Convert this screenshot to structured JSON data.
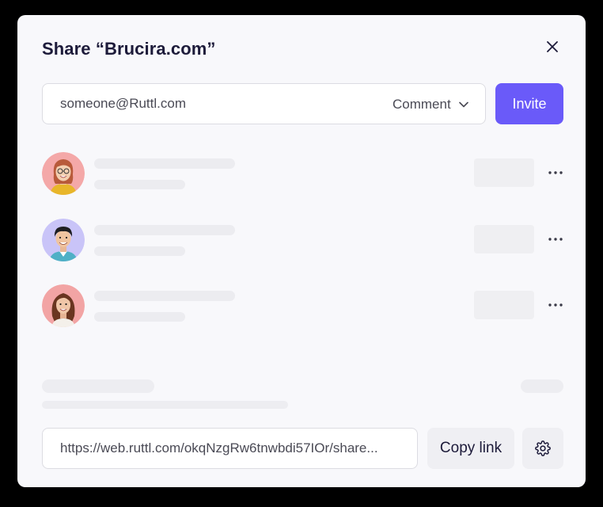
{
  "dialog": {
    "title": "Share “Brucira.com”",
    "close_icon": "close-icon"
  },
  "invite": {
    "email_placeholder": "someone@Ruttl.com",
    "role_selected": "Comment",
    "role_icon": "chevron-down-icon",
    "button_label": "Invite",
    "accent_color": "#6a5af9"
  },
  "members": [
    {
      "avatar_bg": "#f4a8a8",
      "more_icon": "more-horizontal-icon"
    },
    {
      "avatar_bg": "#c9c4f8",
      "more_icon": "more-horizontal-icon"
    },
    {
      "avatar_bg": "#f2a4a4",
      "more_icon": "more-horizontal-icon"
    }
  ],
  "share_link": {
    "url": "https://web.ruttl.com/okqNzgRw6tnwbdi57IOr/share...",
    "copy_label": "Copy link",
    "settings_icon": "gear-icon"
  }
}
